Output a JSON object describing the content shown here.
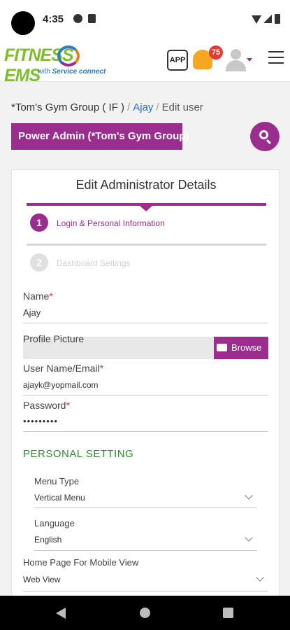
{
  "status_bar": {
    "time": "4:35"
  },
  "header": {
    "logo": {
      "main": "FITNESS",
      "suffix": "EMS",
      "tagline_prefix": "with",
      "tagline": "Service connect"
    },
    "app_icon_label": "APP",
    "notification_count": "75",
    "icons": [
      "app-icon",
      "bell-icon",
      "user-avatar-icon",
      "hamburger-menu-icon"
    ]
  },
  "breadcrumb": {
    "group": "*Tom's Gym Group ( IF )",
    "separator": "/",
    "user": "Ajay",
    "current": "Edit user"
  },
  "role_button": "Power Admin (*Tom's Gym Group)",
  "form": {
    "title": "Edit Administrator Details",
    "steps": [
      {
        "number": "1",
        "label": "Login & Personal Information",
        "active": true
      },
      {
        "number": "2",
        "label": "Dashboard Settings",
        "active": false
      }
    ],
    "fields": {
      "name": {
        "label": "Name",
        "required": "*",
        "value": "Ajay"
      },
      "profile_picture": {
        "label": "Profile Picture",
        "browse_label": "Browse"
      },
      "username": {
        "label": "User Name/Email",
        "required": "*",
        "value": "ajayk@yopmail.com"
      },
      "password": {
        "label": "Password",
        "required": "*",
        "value": "•••••••••"
      }
    },
    "personal_setting": {
      "title": "PERSONAL SETTING",
      "menu_type": {
        "label": "Menu Type",
        "value": "Vertical Menu"
      },
      "language": {
        "label": "Language",
        "value": "English"
      },
      "home_page": {
        "label": "Home Page For Mobile View",
        "value": "Web View"
      }
    }
  },
  "colors": {
    "brand_purple": "#9b2d8f",
    "section_green": "#2e8b2e",
    "link_blue": "#2a6ebb",
    "badge_red": "#e53935",
    "bell_orange": "#f5a623"
  }
}
